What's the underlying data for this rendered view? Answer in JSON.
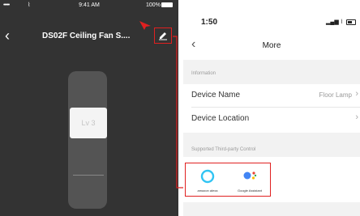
{
  "left_screen": {
    "status": {
      "carrier": "•••••",
      "wifi": "⌇",
      "time": "9:41 AM",
      "battery": "100%"
    },
    "nav": {
      "back": "‹",
      "title": "DS02F Ceiling Fan S...."
    },
    "slider": {
      "knob_label": "Lv 3"
    }
  },
  "right_screen": {
    "status": {
      "time": "1:50",
      "signal": "▂▄▆",
      "wifi": "⌇"
    },
    "nav": {
      "back": "‹",
      "title": "More"
    },
    "information": {
      "section_label": "Information",
      "rows": [
        {
          "label": "Device Name",
          "value": "Floor Lamp",
          "chevron": "›"
        },
        {
          "label": "Device Location",
          "value": "",
          "chevron": "›"
        }
      ]
    },
    "third_party": {
      "section_label": "Supported Third-party Control",
      "items": [
        {
          "label": "amazon alexa",
          "icon": "alexa-icon"
        },
        {
          "label": "Google Assistant",
          "icon": "google-assistant-icon"
        }
      ]
    }
  },
  "colors": {
    "highlight": "#e02020",
    "left_background": "#333333",
    "alexa_blue": "#31c4f3",
    "google_blue": "#4285f4",
    "google_red": "#ea4335",
    "google_yellow": "#fbbc05",
    "google_green": "#34a853"
  }
}
